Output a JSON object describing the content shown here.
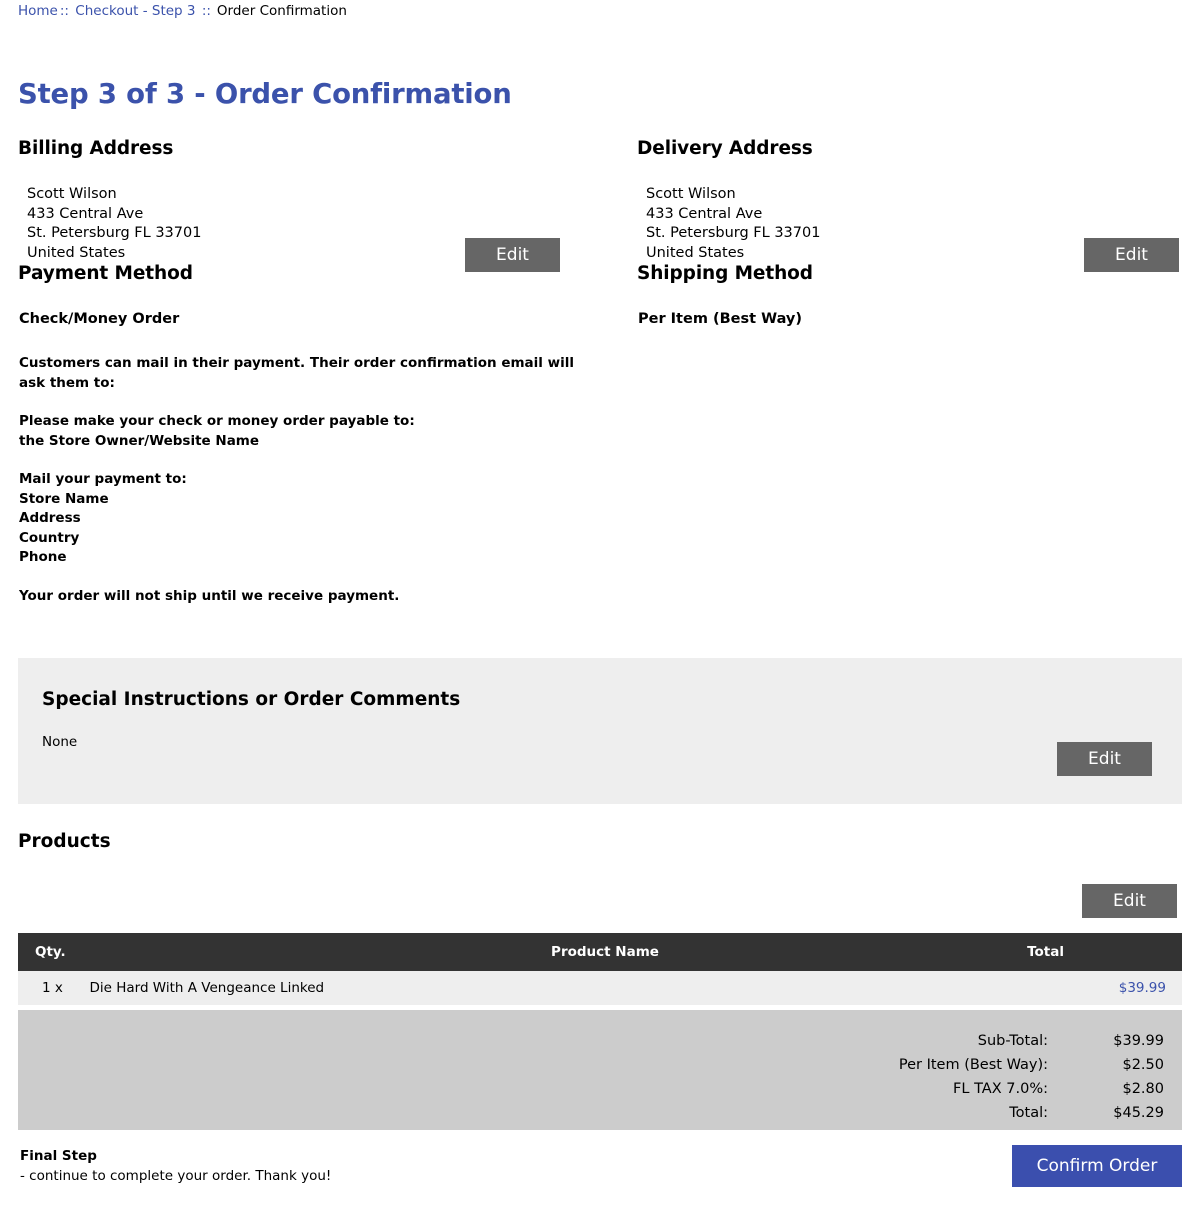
{
  "breadcrumb": {
    "home": "Home",
    "separator": "::",
    "checkout": "Checkout - Step 3",
    "current": "Order Confirmation"
  },
  "page": {
    "title": "Step 3 of 3 - Order Confirmation",
    "accent_color": "#3b52ab",
    "button_gray": "#666666",
    "button_blue": "#3b4fae",
    "panel_gray": "#eeeeee",
    "totals_gray": "#cccccc",
    "table_header_dark": "#333333"
  },
  "billing": {
    "heading": "Billing Address",
    "lines": [
      "Scott Wilson",
      "433 Central Ave",
      "St. Petersburg FL 33701",
      "United States"
    ],
    "edit_label": "Edit"
  },
  "delivery": {
    "heading": "Delivery Address",
    "lines": [
      "Scott Wilson",
      "433 Central Ave",
      "St. Petersburg FL 33701",
      "United States"
    ],
    "edit_label": "Edit"
  },
  "payment": {
    "heading": "Payment Method",
    "method": "Check/Money Order",
    "paragraphs": [
      "Customers can mail in their payment. Their order confirmation email will ask them to:",
      "Please make your check or money order payable to:\nthe Store Owner/Website Name",
      "Mail your payment to:\nStore Name\nAddress\nCountry\nPhone",
      "Your order will not ship until we receive payment."
    ]
  },
  "shipping": {
    "heading": "Shipping Method",
    "method": "Per Item (Best Way)"
  },
  "special_instructions": {
    "heading": "Special Instructions or Order Comments",
    "value": "None",
    "edit_label": "Edit"
  },
  "products": {
    "heading": "Products",
    "edit_label": "Edit",
    "columns": {
      "qty": "Qty.",
      "name": "Product Name",
      "total": "Total"
    },
    "rows": [
      {
        "qty": "1 x",
        "name": "Die Hard With A Vengeance Linked",
        "total": "$39.99"
      }
    ]
  },
  "totals": [
    {
      "label": "Sub-Total:",
      "value": "$39.99"
    },
    {
      "label": "Per Item (Best Way):",
      "value": "$2.50"
    },
    {
      "label": "FL TAX 7.0%:",
      "value": "$2.80"
    },
    {
      "label": "Total:",
      "value": "$45.29"
    }
  ],
  "footer": {
    "title": "Final Step",
    "subtitle": "- continue to complete your order. Thank you!",
    "confirm_label": "Confirm Order"
  }
}
